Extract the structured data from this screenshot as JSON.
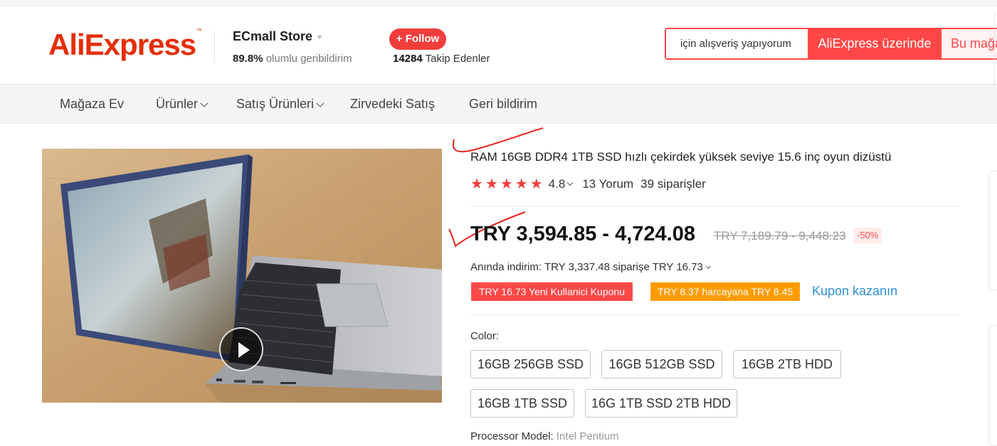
{
  "header": {
    "logo_text": "AliExpress",
    "logo_tm": "™",
    "store_name": "ECmall Store",
    "feedback_percent": "89.8%",
    "feedback_text": "olumlu geribildirim",
    "follow_label": "+ Follow",
    "followers_count": "14284",
    "followers_text": "Takip Edenler",
    "search_value": "için alışveriş yapıyorum",
    "search_btn_global": "AliExpress üzerinde",
    "search_btn_store": "Bu mağa"
  },
  "nav": {
    "items": [
      {
        "label": "Mağaza Ev"
      },
      {
        "label": "Ürünler"
      },
      {
        "label": "Satış Ürünleri"
      },
      {
        "label": "Zirvedeki Satış"
      },
      {
        "label": "Geri bildirim"
      }
    ]
  },
  "product": {
    "title": "RAM 16GB DDR4 1TB SSD hızlı çekirdek yüksek seviye 15.6 inç oyun dizüstü",
    "rating": "4.8",
    "stars": 5,
    "reviews": "13 Yorum",
    "orders": "39 siparişler",
    "price": "TRY 3,594.85 - 4,724.08",
    "original_price": "TRY 7,189.79 - 9,448.23",
    "discount": "-50%",
    "instant_discount": "Anında indirim: TRY 3,337.48 siparişe TRY 16.73",
    "coupons": [
      {
        "label": "TRY 16.73 Yeni Kullanici Kuponu"
      },
      {
        "label": "TRY 8.37 harcayana TRY 8.45"
      }
    ],
    "coupon_link": "Kupon kazanın",
    "color_label": "Color:",
    "color_options": [
      {
        "label": "16GB 256GB SSD"
      },
      {
        "label": "16GB 512GB SSD"
      },
      {
        "label": "16GB 2TB HDD"
      },
      {
        "label": "16GB 1TB SSD"
      },
      {
        "label": "16G 1TB SSD 2TB HDD"
      }
    ],
    "processor_label": "Processor Model:",
    "processor_value": "Intel Pentium"
  },
  "colors": {
    "brand_red": "#ff4747",
    "star_red": "#f23d3d",
    "coupon_orange": "#ff9b00",
    "link_blue": "#2e8fd6",
    "annotation_red": "#e8231d"
  }
}
